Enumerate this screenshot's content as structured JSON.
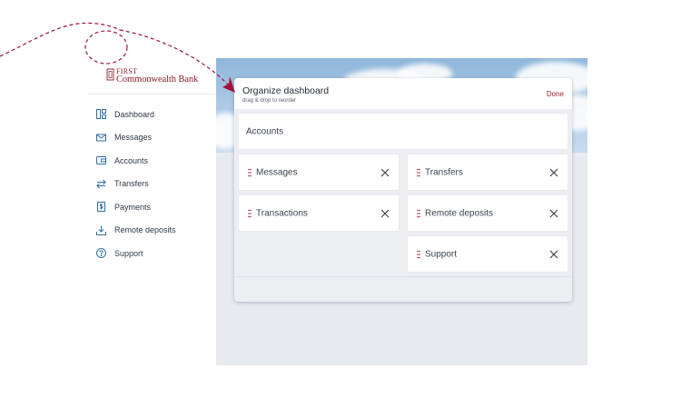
{
  "brand": {
    "name_line1": "FIRST",
    "name_line2": "Commonwealth Bank",
    "color": "#8a1c2e"
  },
  "sidebar": {
    "items": [
      {
        "label": "Dashboard",
        "icon": "dashboard-icon"
      },
      {
        "label": "Messages",
        "icon": "envelope-icon"
      },
      {
        "label": "Accounts",
        "icon": "wallet-icon"
      },
      {
        "label": "Transfers",
        "icon": "transfer-arrows-icon"
      },
      {
        "label": "Payments",
        "icon": "dollar-document-icon"
      },
      {
        "label": "Remote deposits",
        "icon": "download-tray-icon"
      },
      {
        "label": "Support",
        "icon": "question-circle-icon"
      }
    ]
  },
  "modal": {
    "title": "Organize dashboard",
    "subtitle": "drag & drop to reorder",
    "done_label": "Done",
    "fixed_card": "Accounts",
    "left_cards": [
      "Messages",
      "Transactions"
    ],
    "right_cards": [
      "Transfers",
      "Remote deposits",
      "Support"
    ]
  },
  "colors": {
    "accent": "#9b2335",
    "icon_blue": "#2f6ea5",
    "annotation": "#a3123a"
  }
}
